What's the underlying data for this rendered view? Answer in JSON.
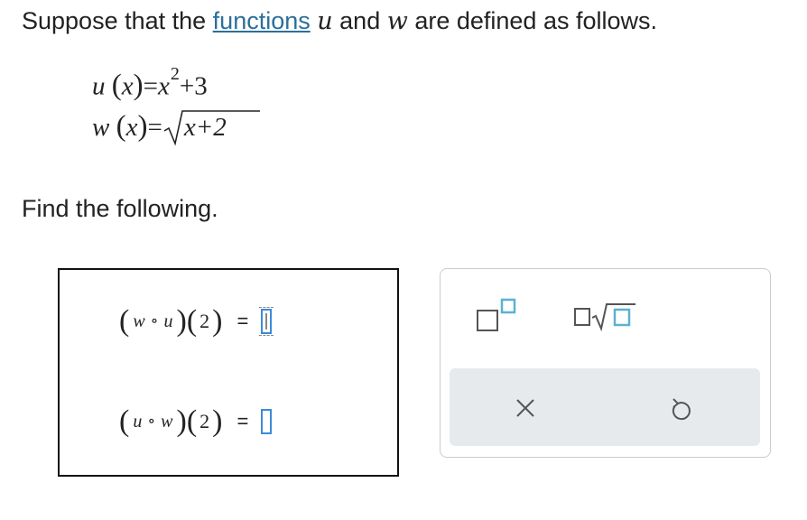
{
  "intro": {
    "prefix": "Suppose that the ",
    "link": "functions",
    "var_u": "u",
    "mid": " and ",
    "var_w": "w",
    "suffix": " are defined as follows."
  },
  "definitions": {
    "u": {
      "name": "u",
      "open": "(",
      "arg": "x",
      "close": ")",
      "eq": "=",
      "base": "x",
      "exp": "2",
      "rest": "+3"
    },
    "w": {
      "name": "w",
      "open": "(",
      "arg": "x",
      "close": ")",
      "eq": "=",
      "radicand": "x+2"
    }
  },
  "prompt": "Find the following.",
  "answers": [
    {
      "open": "(",
      "outer": "w",
      "ring": "∘",
      "inner": "u",
      "close": ")",
      "arg_open": "(",
      "arg": "2",
      "arg_close": ")",
      "eq": "=",
      "value": ""
    },
    {
      "open": "(",
      "outer": "u",
      "ring": "∘",
      "inner": "w",
      "close": ")",
      "arg_open": "(",
      "arg": "2",
      "arg_close": ")",
      "eq": "=",
      "value": ""
    }
  ],
  "keypad": {
    "buttons": [
      "exponent-icon",
      "square-root-icon"
    ],
    "actions": [
      "clear-icon",
      "undo-icon"
    ]
  },
  "colors": {
    "link": "#2b6f9a",
    "input_border": "#3b8bd8",
    "key_accent": "#5bb1d2",
    "action_bar": "#e7eaec"
  }
}
